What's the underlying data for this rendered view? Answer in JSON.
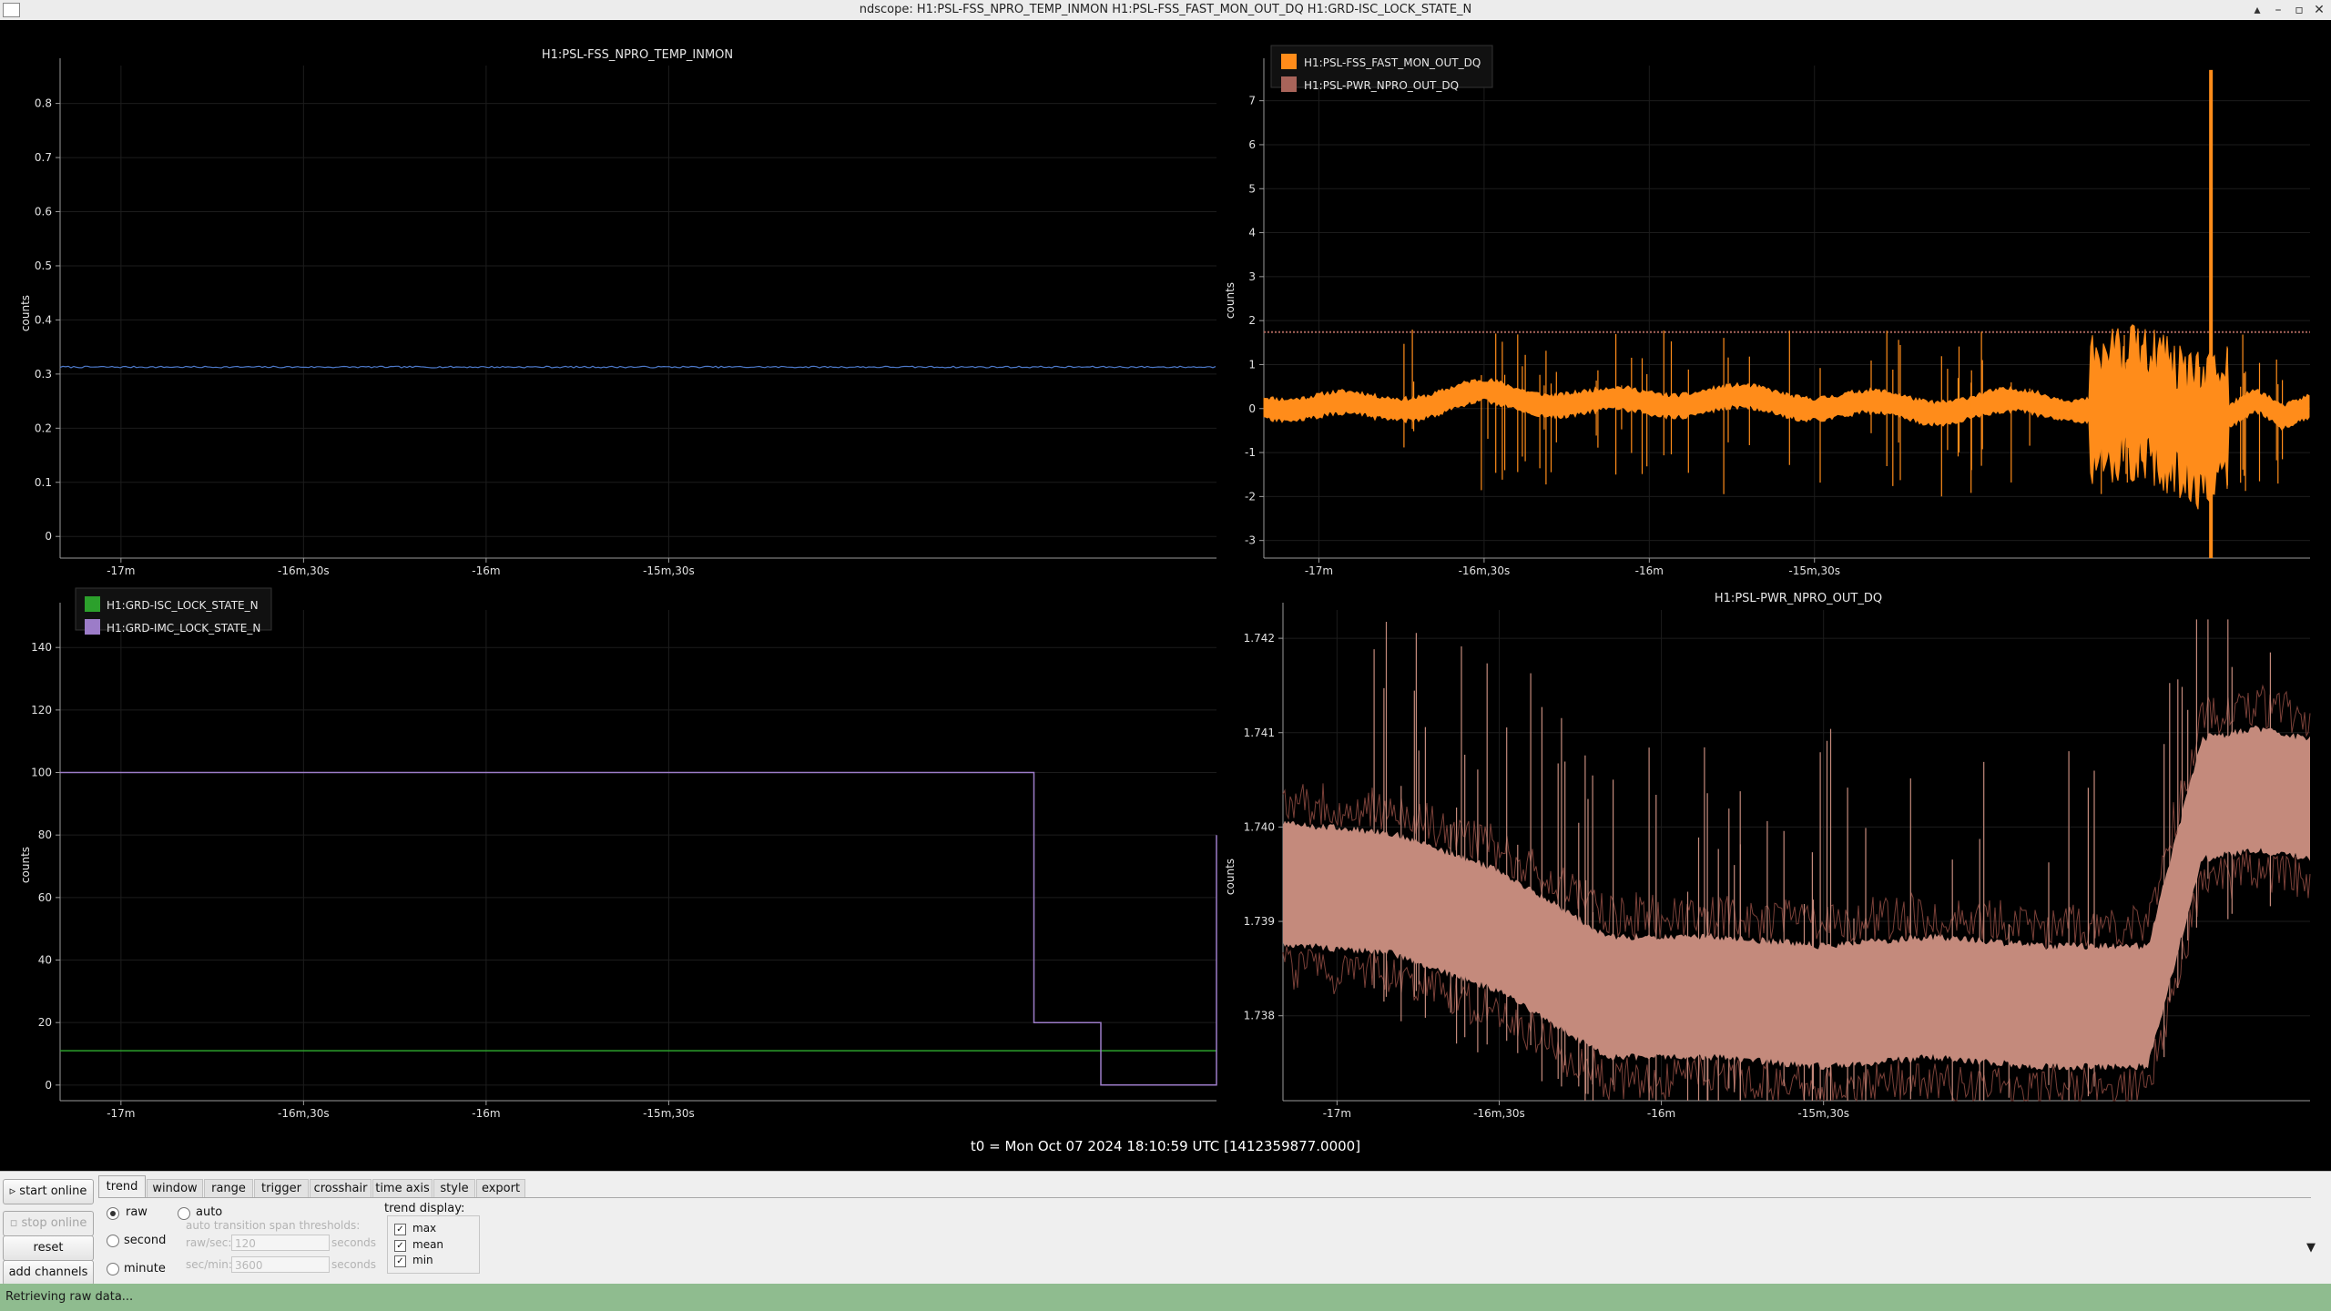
{
  "window": {
    "title": "ndscope: H1:PSL-FSS_NPRO_TEMP_INMON H1:PSL-FSS_FAST_MON_OUT_DQ H1:GRD-ISC_LOCK_STATE_N",
    "buttons": [
      "▴",
      "–",
      "▫",
      "✕"
    ]
  },
  "plots": {
    "x_ticks": [
      "-17m",
      "-16m,30s",
      "-16m",
      "-15m,30s"
    ],
    "top_left": {
      "title": "H1:PSL-FSS_NPRO_TEMP_INMON",
      "ylabel": "counts",
      "y_ticks": [
        "0.8",
        "0.7",
        "0.6",
        "0.5",
        "0.4",
        "0.3",
        "0.2",
        "0.1",
        "0"
      ]
    },
    "top_right": {
      "ylabel": "counts",
      "y_ticks": [
        "7",
        "6",
        "5",
        "4",
        "3",
        "2",
        "1",
        "0",
        "-1",
        "-2",
        "-3"
      ],
      "legend": [
        "H1:PSL-FSS_FAST_MON_OUT_DQ",
        "H1:PSL-PWR_NPRO_OUT_DQ"
      ]
    },
    "bottom_left": {
      "ylabel": "counts",
      "y_ticks": [
        "140",
        "120",
        "100",
        "80",
        "60",
        "40",
        "20",
        "0"
      ],
      "legend": [
        "H1:GRD-ISC_LOCK_STATE_N",
        "H1:GRD-IMC_LOCK_STATE_N"
      ]
    },
    "bottom_right": {
      "title": "H1:PSL-PWR_NPRO_OUT_DQ",
      "ylabel": "counts",
      "y_ticks": [
        "1.742",
        "1.741",
        "1.740",
        "1.739",
        "1.738"
      ]
    },
    "t0": "t0 = Mon Oct 07 2024 18:10:59 UTC [1412359877.0000]"
  },
  "colors": {
    "temp": "#4c78c8",
    "fast": "#ff8c1a",
    "pwr": "#a8645a",
    "pwr_fill": "#c48a7c",
    "isc": "#2ca02c",
    "imc": "#9c7cc8"
  },
  "chart_data": [
    {
      "type": "line",
      "title": "H1:PSL-FSS_NPRO_TEMP_INMON",
      "ylabel": "counts",
      "ylim": [
        -0.04,
        0.87
      ],
      "x_ticks": [
        "-17m",
        "-16m,30s",
        "-16m",
        "-15m,30s"
      ],
      "series": [
        {
          "name": "H1:PSL-FSS_NPRO_TEMP_INMON",
          "x": [
            -1030,
            -840
          ],
          "y": [
            0.313,
            0.313
          ]
        }
      ]
    },
    {
      "type": "line",
      "ylabel": "counts",
      "ylim": [
        -3.4,
        7.8
      ],
      "x_ticks": [
        "-17m",
        "-16m,30s",
        "-16m",
        "-15m,30s"
      ],
      "series": [
        {
          "name": "H1:PSL-FSS_FAST_MON_OUT_DQ",
          "x": [
            -1030,
            -1010,
            -990,
            -970,
            -950,
            -930,
            -910,
            -890,
            -870,
            -860,
            -850,
            -845,
            -840
          ],
          "y": [
            0.1,
            0.0,
            0.3,
            0.1,
            0.2,
            0.1,
            0.0,
            0.1,
            0.0,
            -0.4,
            0.1,
            -0.3,
            0.1
          ]
        },
        {
          "name": "H1:PSL-PWR_NPRO_OUT_DQ",
          "x": [
            -1030,
            -840
          ],
          "y": [
            1.74,
            1.74
          ]
        }
      ]
    },
    {
      "type": "line",
      "ylabel": "counts",
      "ylim": [
        -5,
        152
      ],
      "x_ticks": [
        "-17m",
        "-16m,30s",
        "-16m",
        "-15m,30s"
      ],
      "series": [
        {
          "name": "H1:GRD-ISC_LOCK_STATE_N",
          "x": [
            -1030,
            -840
          ],
          "y": [
            11,
            11
          ]
        },
        {
          "name": "H1:GRD-IMC_LOCK_STATE_N",
          "x": [
            -1030,
            -870,
            -870,
            -859,
            -859,
            -837,
            -837,
            -827
          ],
          "y": [
            100,
            100,
            20,
            20,
            0,
            0,
            80,
            80
          ]
        }
      ]
    },
    {
      "type": "area",
      "title": "H1:PSL-PWR_NPRO_OUT_DQ",
      "ylabel": "counts",
      "ylim": [
        1.7371,
        1.7423
      ],
      "x_ticks": [
        "-17m",
        "-16m,30s",
        "-16m",
        "-15m,30s"
      ],
      "series": [
        {
          "name": "H1:PSL-PWR_NPRO_OUT_DQ",
          "x": [
            -1030,
            -1010,
            -990,
            -970,
            -950,
            -930,
            -910,
            -890,
            -870,
            -860,
            -850,
            -840
          ],
          "y": [
            1.7394,
            1.7393,
            1.7389,
            1.7382,
            1.7382,
            1.7381,
            1.7382,
            1.7381,
            1.7381,
            1.7403,
            1.7404,
            1.7403
          ]
        }
      ]
    }
  ]
}
